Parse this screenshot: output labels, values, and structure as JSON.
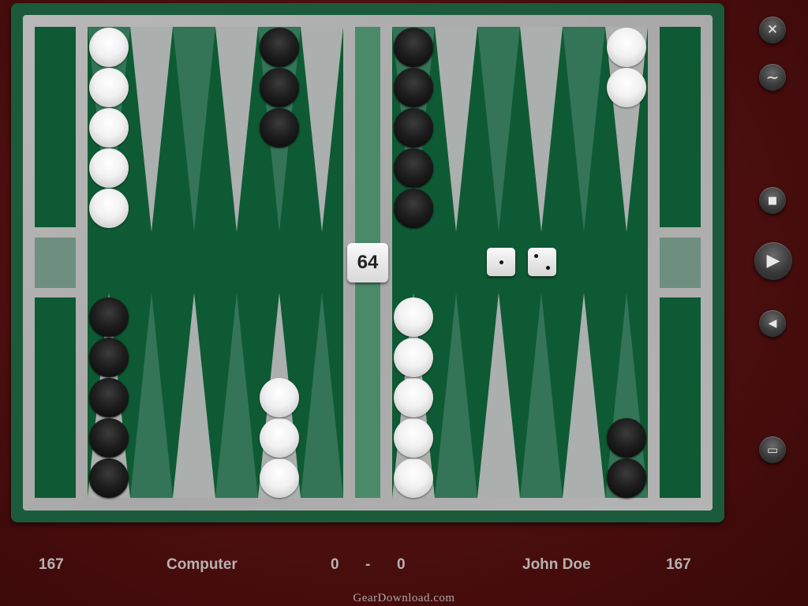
{
  "colors": {
    "background": "#4a0e0e",
    "board_frame": "#1c5a3c",
    "felt": "#0e5a34",
    "light_point": "#b4b4b4",
    "dark_point": "#3b7a5e",
    "score_text": "#b9b1b1"
  },
  "board": {
    "top_row": [
      {
        "point": "top-1",
        "color": "white",
        "count": 5
      },
      {
        "point": "top-2",
        "color": null,
        "count": 0
      },
      {
        "point": "top-3",
        "color": null,
        "count": 0
      },
      {
        "point": "top-4",
        "color": null,
        "count": 0
      },
      {
        "point": "top-5",
        "color": "black",
        "count": 3
      },
      {
        "point": "top-6",
        "color": null,
        "count": 0
      },
      {
        "point": "top-7",
        "color": "black",
        "count": 5
      },
      {
        "point": "top-8",
        "color": null,
        "count": 0
      },
      {
        "point": "top-9",
        "color": null,
        "count": 0
      },
      {
        "point": "top-10",
        "color": null,
        "count": 0
      },
      {
        "point": "top-11",
        "color": null,
        "count": 0
      },
      {
        "point": "top-12",
        "color": "white",
        "count": 2
      }
    ],
    "bottom_row": [
      {
        "point": "bottom-1",
        "color": "black",
        "count": 5
      },
      {
        "point": "bottom-2",
        "color": null,
        "count": 0
      },
      {
        "point": "bottom-3",
        "color": null,
        "count": 0
      },
      {
        "point": "bottom-4",
        "color": null,
        "count": 0
      },
      {
        "point": "bottom-5",
        "color": "white",
        "count": 3
      },
      {
        "point": "bottom-6",
        "color": null,
        "count": 0
      },
      {
        "point": "bottom-7",
        "color": "white",
        "count": 5
      },
      {
        "point": "bottom-8",
        "color": null,
        "count": 0
      },
      {
        "point": "bottom-9",
        "color": null,
        "count": 0
      },
      {
        "point": "bottom-10",
        "color": null,
        "count": 0
      },
      {
        "point": "bottom-11",
        "color": null,
        "count": 0
      },
      {
        "point": "bottom-12",
        "color": "black",
        "count": 2
      }
    ]
  },
  "doubling_cube": {
    "value": "64"
  },
  "dice": [
    1,
    2
  ],
  "controls": [
    {
      "name": "close-button",
      "icon": "close-icon",
      "glyph": "✕"
    },
    {
      "name": "minimize-button",
      "icon": "tilde-icon",
      "glyph": "~"
    },
    {
      "name": "stop-button",
      "icon": "stop-icon",
      "glyph": "■"
    },
    {
      "name": "play-button",
      "icon": "play-icon",
      "glyph": "▶"
    },
    {
      "name": "back-button",
      "icon": "back-icon",
      "glyph": "◀"
    },
    {
      "name": "window-button",
      "icon": "window-icon",
      "glyph": "▭"
    }
  ],
  "scores": {
    "left_pip_count": "167",
    "player1_name": "Computer",
    "player1_score": "0",
    "separator": "-",
    "player2_score": "0",
    "player2_name": "John Doe",
    "right_pip_count": "167"
  },
  "watermark": "GearDownload.com"
}
